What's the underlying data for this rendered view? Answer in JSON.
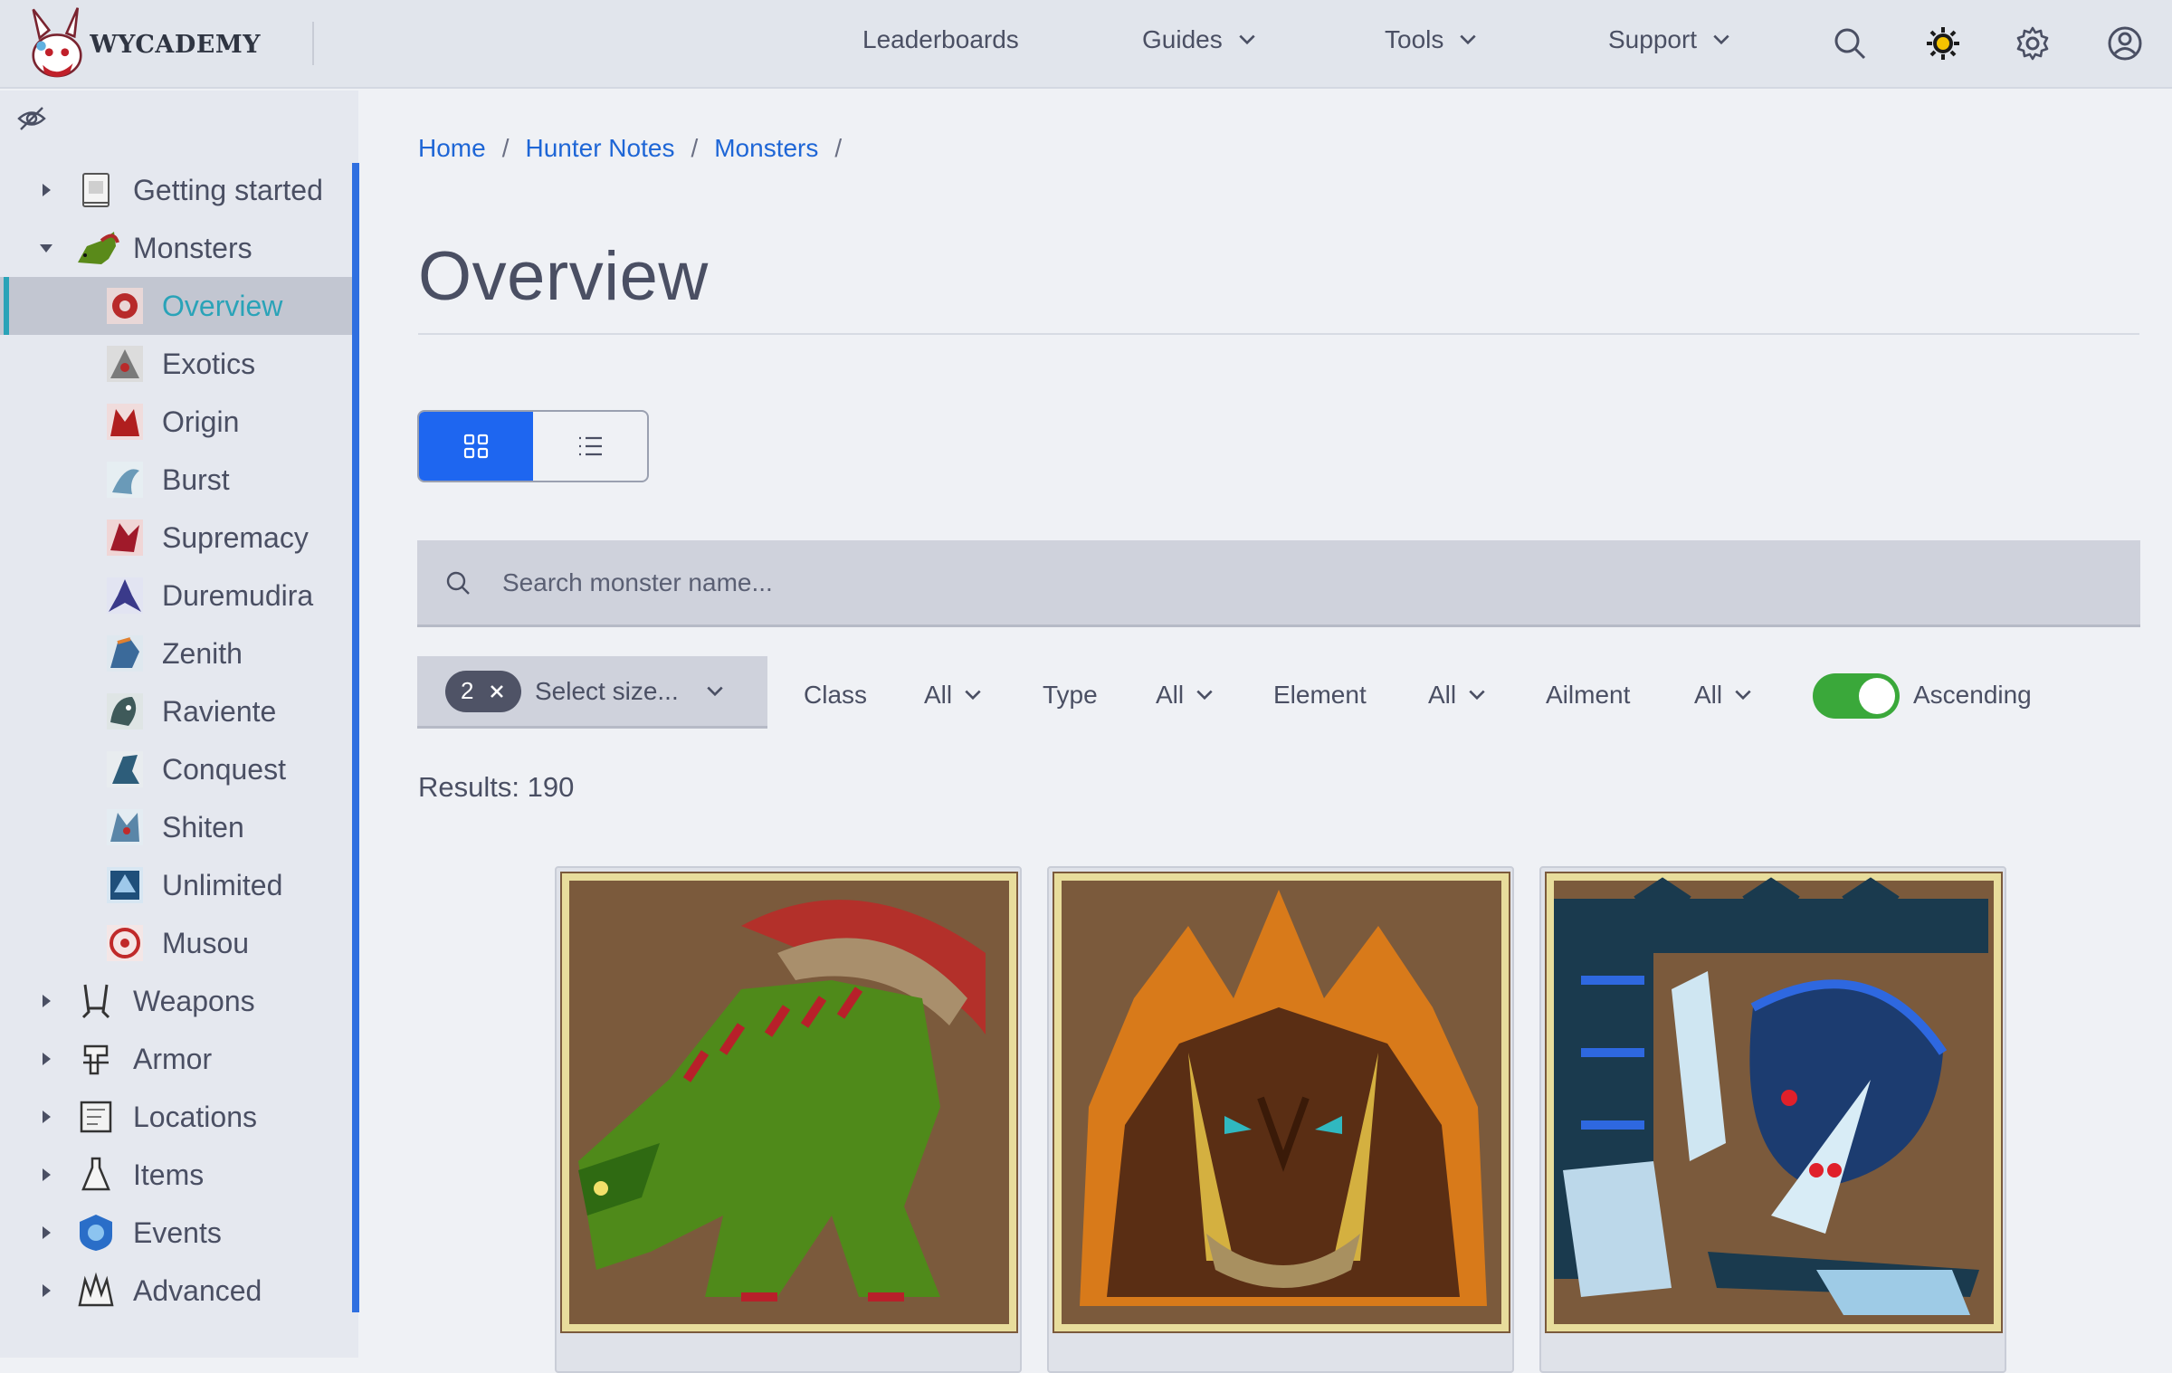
{
  "brand": {
    "name": "WYCADEMY"
  },
  "nav": {
    "leaderboards": "Leaderboards",
    "guides": "Guides",
    "tools": "Tools",
    "support": "Support"
  },
  "sidebar": {
    "items": [
      {
        "label": "Getting started",
        "icon": "book-icon"
      },
      {
        "label": "Monsters",
        "icon": "monster-icon"
      },
      {
        "label": "Overview",
        "icon": "overview-icon"
      },
      {
        "label": "Exotics",
        "icon": "exotics-icon"
      },
      {
        "label": "Origin",
        "icon": "origin-icon"
      },
      {
        "label": "Burst",
        "icon": "burst-icon"
      },
      {
        "label": "Supremacy",
        "icon": "supremacy-icon"
      },
      {
        "label": "Duremudira",
        "icon": "duremudira-icon"
      },
      {
        "label": "Zenith",
        "icon": "zenith-icon"
      },
      {
        "label": "Raviente",
        "icon": "raviente-icon"
      },
      {
        "label": "Conquest",
        "icon": "conquest-icon"
      },
      {
        "label": "Shiten",
        "icon": "shiten-icon"
      },
      {
        "label": "Unlimited",
        "icon": "unlimited-icon"
      },
      {
        "label": "Musou",
        "icon": "musou-icon"
      },
      {
        "label": "Weapons",
        "icon": "weapons-icon"
      },
      {
        "label": "Armor",
        "icon": "armor-icon"
      },
      {
        "label": "Locations",
        "icon": "map-icon"
      },
      {
        "label": "Items",
        "icon": "items-icon"
      },
      {
        "label": "Events",
        "icon": "events-icon"
      },
      {
        "label": "Advanced",
        "icon": "advanced-icon"
      }
    ],
    "active": "Overview"
  },
  "breadcrumb": {
    "items": [
      "Home",
      "Hunter Notes",
      "Monsters"
    ],
    "separator": "/"
  },
  "page": {
    "title": "Overview"
  },
  "search": {
    "placeholder": "Search monster name..."
  },
  "filters": {
    "size_count": "2",
    "size_placeholder": "Select size...",
    "class_label": "Class",
    "class_value": "All",
    "type_label": "Type",
    "type_value": "All",
    "element_label": "Element",
    "element_value": "All",
    "ailment_label": "Ailment",
    "ailment_value": "All",
    "ascending_label": "Ascending",
    "ascending_on": true
  },
  "results": {
    "text": "Results: 190"
  },
  "colors": {
    "accent": "#1e66f0",
    "active_item": "#2aa3b8",
    "link": "#1e66d6",
    "toggle_on": "#3aa83a"
  }
}
